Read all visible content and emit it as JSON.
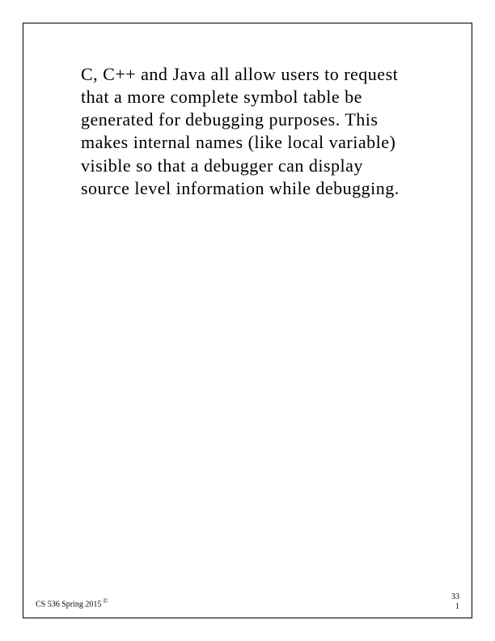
{
  "body": {
    "paragraph": "C, C++ and Java all allow users to request that a more complete symbol table be generated for debugging purposes. This makes internal names (like local variable) visible so that a debugger can display source level information while debugging."
  },
  "footer": {
    "course": "CS 536  Spring 2015",
    "copyright": "©",
    "page_top": "33",
    "page_bottom": "1"
  }
}
